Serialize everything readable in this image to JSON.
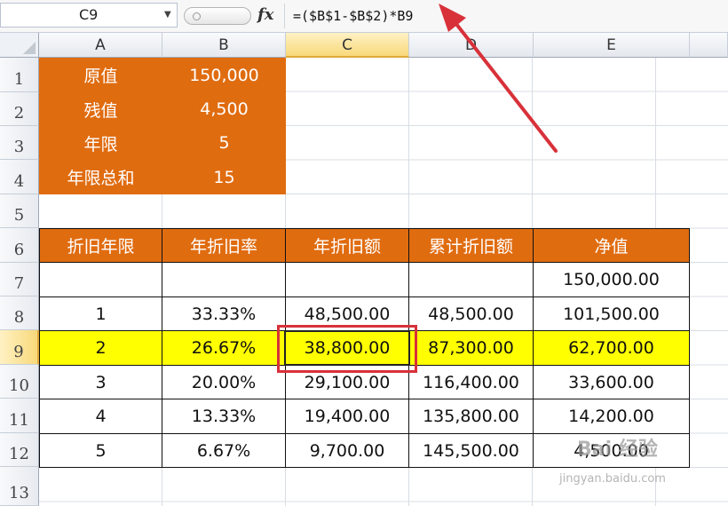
{
  "formula_bar": {
    "name_box": "C9",
    "fx_label": "fx",
    "formula": "=($B$1-$B$2)*B9"
  },
  "columns": [
    "A",
    "B",
    "C",
    "D",
    "E"
  ],
  "rows": [
    "1",
    "2",
    "3",
    "4",
    "5",
    "6",
    "7",
    "8",
    "9",
    "10",
    "11",
    "12",
    "13"
  ],
  "params": [
    {
      "label": "原值",
      "value": "150,000"
    },
    {
      "label": "残值",
      "value": "4,500"
    },
    {
      "label": "年限",
      "value": "5"
    },
    {
      "label": "年限总和",
      "value": "15"
    }
  ],
  "table": {
    "headers": [
      "折旧年限",
      "年折旧率",
      "年折旧额",
      "累计折旧额",
      "净值"
    ],
    "rows": [
      [
        "",
        "",
        "",
        "",
        "150,000.00"
      ],
      [
        "1",
        "33.33%",
        "48,500.00",
        "48,500.00",
        "101,500.00"
      ],
      [
        "2",
        "26.67%",
        "38,800.00",
        "87,300.00",
        "62,700.00"
      ],
      [
        "3",
        "20.00%",
        "29,100.00",
        "116,400.00",
        "33,600.00"
      ],
      [
        "4",
        "13.33%",
        "19,400.00",
        "135,800.00",
        "14,200.00"
      ],
      [
        "5",
        "6.67%",
        "9,700.00",
        "145,500.00",
        "4,500.00"
      ]
    ]
  },
  "colors": {
    "orange": "#e06c10",
    "highlight": "#ffff00",
    "annotation": "#d8313a"
  },
  "watermark": {
    "brand": "Bai 经验",
    "url": "jingyan.baidu.com"
  }
}
